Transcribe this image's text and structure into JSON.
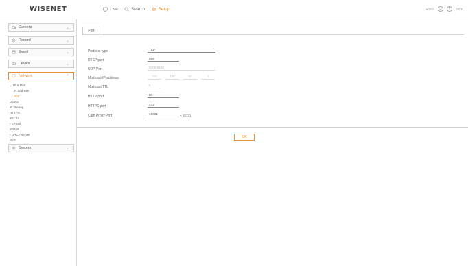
{
  "header": {
    "logo": "WISENET",
    "nav": [
      {
        "label": "Live",
        "icon": "monitor-icon",
        "active": false
      },
      {
        "label": "Search",
        "icon": "search-icon",
        "active": false
      },
      {
        "label": "Setup",
        "icon": "gear-icon",
        "active": true
      }
    ],
    "user": "admin",
    "help_label": "?",
    "exit_label": "EXIT"
  },
  "sidebar": {
    "menus": {
      "camera": "Camera",
      "record": "Record",
      "event": "Event",
      "device": "Device",
      "network": "Network",
      "system": "System"
    },
    "submenu": {
      "ip_port": "IP & Port",
      "ip_address": "IP address",
      "port": "Port",
      "ddns": "DDNS",
      "ip_filtering": "IP filtering",
      "https": "HTTPS",
      "8021x": "802.1x",
      "email": "E-mail",
      "snmp": "SNMP",
      "dhcp_server": "DHCP server",
      "p2p": "P2P"
    }
  },
  "main": {
    "tab": "Port",
    "form": {
      "protocol_type": {
        "label": "Protocol type",
        "value": "TCP"
      },
      "rtsp_port": {
        "label": "RTSP port",
        "value": "558"
      },
      "udp_port": {
        "label": "UDP Port",
        "value": "8000-8159"
      },
      "multicast_ip": {
        "label": "Multicast IP address",
        "octets": [
          "224",
          "126",
          "63",
          "1"
        ]
      },
      "multicast_ttl": {
        "label": "Multicast TTL",
        "value": "5"
      },
      "http_port": {
        "label": "HTTP port",
        "value": "80"
      },
      "https_port": {
        "label": "HTTPS port",
        "value": "443"
      },
      "cam_proxy_port": {
        "label": "Cam Proxy Port",
        "value": "10001",
        "range": "~ 10131"
      }
    },
    "ok_label": "OK"
  },
  "colors": {
    "accent": "#e8913a",
    "border": "#cfcfcf"
  }
}
